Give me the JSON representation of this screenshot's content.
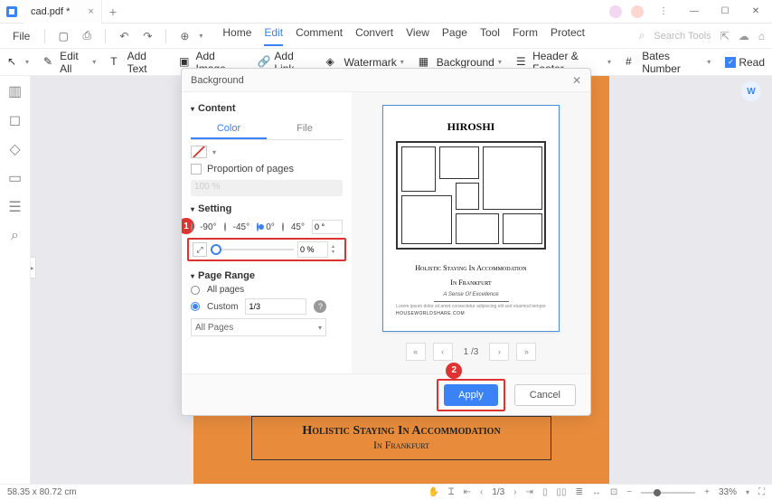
{
  "titlebar": {
    "tab_name": "cad.pdf *"
  },
  "menubar": {
    "file": "File",
    "menus": [
      "Home",
      "Edit",
      "Comment",
      "Convert",
      "View",
      "Page",
      "Tool",
      "Form",
      "Protect"
    ],
    "search_placeholder": "Search Tools"
  },
  "toolbar": {
    "edit_all": "Edit All",
    "add_text": "Add Text",
    "add_image": "Add Image",
    "add_link": "Add Link",
    "watermark": "Watermark",
    "background": "Background",
    "header_footer": "Header & Footer",
    "bates_number": "Bates Number",
    "read": "Read"
  },
  "dialog": {
    "title": "Background",
    "sections": {
      "content": "Content",
      "setting": "Setting",
      "page_range": "Page Range"
    },
    "subtabs": {
      "color": "Color",
      "file": "File"
    },
    "proportion_label": "Proportion of pages",
    "proportion_value": "100 %",
    "rotation": {
      "opts": [
        "-90°",
        "-45°",
        "0°",
        "45°"
      ],
      "custom_value": "0 °"
    },
    "opacity": "0 %",
    "page_range": {
      "all": "All pages",
      "custom": "Custom",
      "custom_value": "1/3",
      "select_label": "All Pages"
    },
    "pager": "1 /3",
    "apply": "Apply",
    "cancel": "Cancel"
  },
  "annotations": {
    "badge1": "1",
    "badge2": "2"
  },
  "preview": {
    "title": "HIROSHI",
    "caption_line1": "Holistic Staying In Accommodation",
    "caption_line2": "In Frankfurt",
    "subcaption": "A Sense Of Excellence",
    "footer_text": "HOUSEWORLDSHARE.COM"
  },
  "behind_doc": {
    "heading": "Holistic Staying In Accommodation",
    "sub": "In Frankfurt"
  },
  "statusbar": {
    "dims": "58.35 x 80.72 cm",
    "page": "1/3",
    "zoom": "33%"
  }
}
